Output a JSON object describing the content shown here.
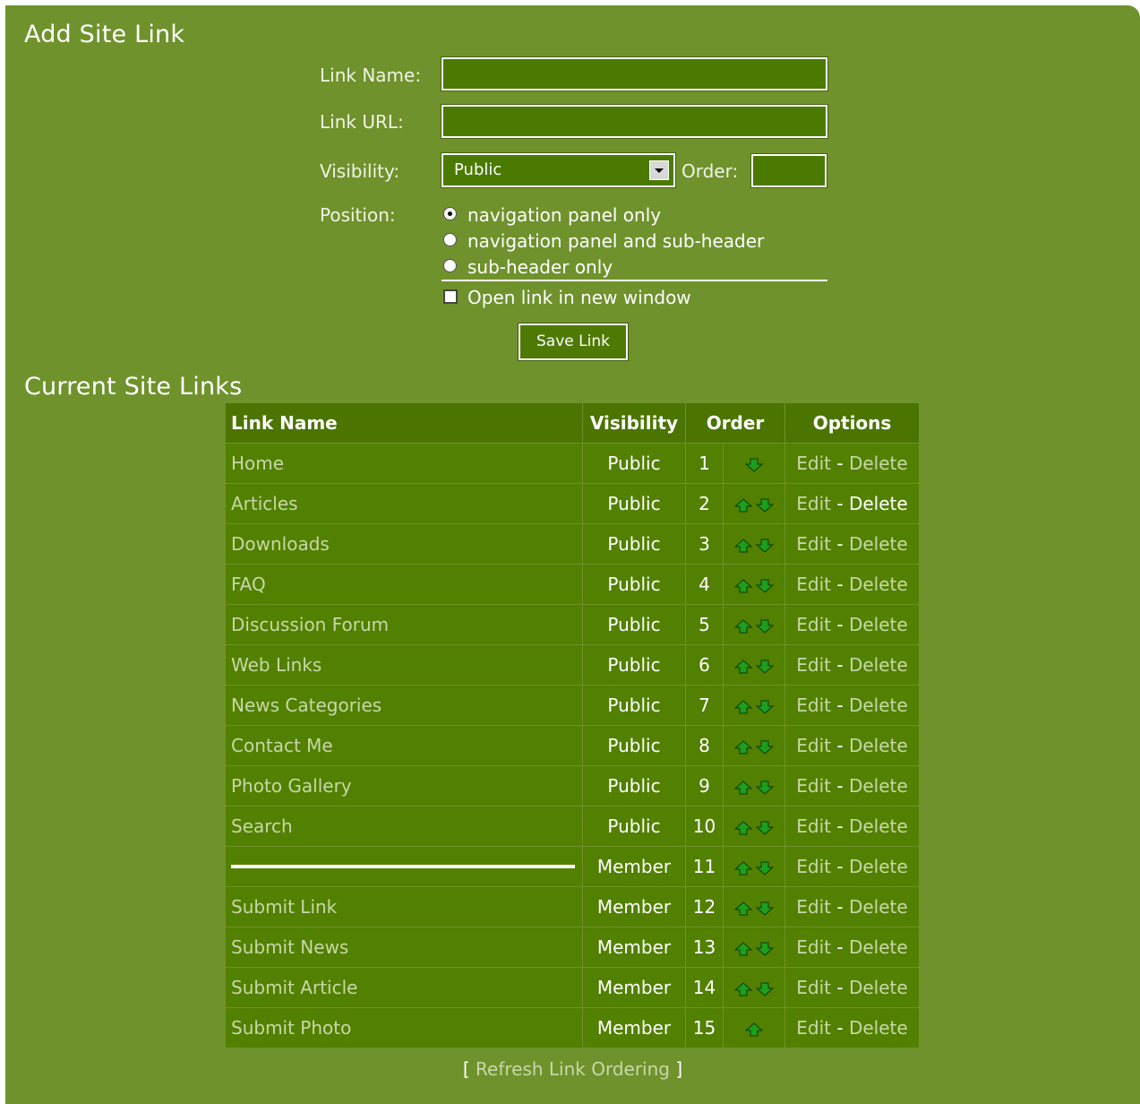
{
  "add_form": {
    "title": "Add Site Link",
    "link_name_label": "Link Name:",
    "link_name_value": "",
    "link_url_label": "Link URL:",
    "link_url_value": "",
    "visibility_label": "Visibility:",
    "visibility_value": "Public",
    "order_label": "Order:",
    "order_value": "",
    "position_label": "Position:",
    "position_options": [
      {
        "label": "navigation panel only",
        "selected": true
      },
      {
        "label": "navigation panel and sub-header",
        "selected": false
      },
      {
        "label": "sub-header only",
        "selected": false
      }
    ],
    "new_window_label": "Open link in new window",
    "new_window_checked": false,
    "save_label": "Save Link"
  },
  "links": {
    "title": "Current Site Links",
    "columns": [
      "Link Name",
      "Visibility",
      "Order",
      "Options"
    ],
    "edit_label": "Edit",
    "separator": "-",
    "delete_label": "Delete",
    "rows": [
      {
        "name": "Home",
        "visibility": "Public",
        "order": "1",
        "up": false,
        "down": true
      },
      {
        "name": "Articles",
        "visibility": "Public",
        "order": "2",
        "up": true,
        "down": true
      },
      {
        "name": "Downloads",
        "visibility": "Public",
        "order": "3",
        "up": true,
        "down": true
      },
      {
        "name": "FAQ",
        "visibility": "Public",
        "order": "4",
        "up": true,
        "down": true
      },
      {
        "name": "Discussion Forum",
        "visibility": "Public",
        "order": "5",
        "up": true,
        "down": true
      },
      {
        "name": "Web Links",
        "visibility": "Public",
        "order": "6",
        "up": true,
        "down": true
      },
      {
        "name": "News Categories",
        "visibility": "Public",
        "order": "7",
        "up": true,
        "down": true
      },
      {
        "name": "Contact Me",
        "visibility": "Public",
        "order": "8",
        "up": true,
        "down": true
      },
      {
        "name": "Photo Gallery",
        "visibility": "Public",
        "order": "9",
        "up": true,
        "down": true
      },
      {
        "name": "Search",
        "visibility": "Public",
        "order": "10",
        "up": true,
        "down": true
      },
      {
        "name": "",
        "visibility": "Member",
        "order": "11",
        "up": true,
        "down": true,
        "separator": true
      },
      {
        "name": "Submit Link",
        "visibility": "Member",
        "order": "12",
        "up": true,
        "down": true
      },
      {
        "name": "Submit News",
        "visibility": "Member",
        "order": "13",
        "up": true,
        "down": true
      },
      {
        "name": "Submit Article",
        "visibility": "Member",
        "order": "14",
        "up": true,
        "down": true
      },
      {
        "name": "Submit Photo",
        "visibility": "Member",
        "order": "15",
        "up": true,
        "down": false
      }
    ],
    "refresh_open": "[",
    "refresh_label": "Refresh Link Ordering",
    "refresh_close": "]"
  },
  "colors": {
    "panel_bg": "#6f922c",
    "row_bg": "#528000",
    "header_bg": "#4b7400",
    "link_text": "#c8d8a8",
    "arrow_green": "#1e9e1e"
  },
  "icons": {
    "up": "up-arrow-icon",
    "down": "down-arrow-icon",
    "select": "chevron-down-icon"
  }
}
